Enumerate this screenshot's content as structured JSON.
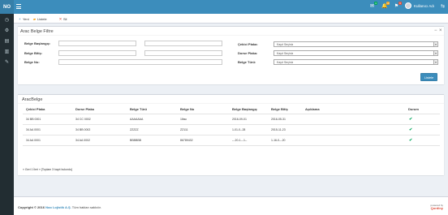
{
  "header": {
    "brand": "NO",
    "user_name": "Kullanıcı Adı",
    "notifications": [
      {
        "icon": "envelope-icon",
        "count": "4",
        "color": "#00a65a"
      },
      {
        "icon": "bell-icon",
        "count": "10",
        "color": "#f39c12"
      },
      {
        "icon": "flag-icon",
        "count": "9",
        "color": "#dd4b39"
      }
    ]
  },
  "sidebar": {
    "icons": [
      "dashboard-icon",
      "settings-icon",
      "chart-icon",
      "file-icon",
      "edit-icon"
    ]
  },
  "toolbar": {
    "new_label": "Yeni",
    "list_label": "Listele",
    "delete_label": "Sil"
  },
  "filter": {
    "title": "Arac Belge Filtre",
    "collapse": "−",
    "close": "×",
    "labels": {
      "start": "Belge Başlangıç:",
      "end": "Belge Bitiş:",
      "no": "Belge No:",
      "tractor_plate": "Çekici Plaka:",
      "trailer_plate": "Dorse Plaka:",
      "doc_type": "Belge Türü:"
    },
    "selects": {
      "tractor_plate": "Kayıt Seçiniz",
      "trailer_plate": "Kayıt Seçiniz",
      "doc_type": "Kayıt Seçiniz"
    },
    "list_button": "Listele"
  },
  "table": {
    "title": "AracBelge",
    "columns": [
      "Çekici Plaka",
      "Dorse Plaka",
      "Belge Türü",
      "Belge No",
      "Belge Başlangıç",
      "Belge Bitiş",
      "Açıklama",
      "Durum"
    ],
    "rows": [
      [
        "34 BB 0001",
        "34 CC 0002",
        "AAAAAAA",
        "1lbsc",
        "2016-09-01",
        "2016-05-31",
        "",
        "check"
      ],
      [
        "34 AA 0001",
        "34 BB 0002",
        "ZZZZZ",
        "ZZ111",
        "1-01-0--28",
        "2015-11-23",
        "",
        "check"
      ],
      [
        "34 AA 0001",
        "34 AA 0002",
        "BBBBBB",
        "86789432",
        "---20-1---1--",
        "1-16-0---20",
        "",
        "check"
      ]
    ],
    "pagination": "« Geri 1 İleri » [Toplam 3 kayıt bulundu]"
  },
  "footer": {
    "copyright_prefix": "Copyright © 2016",
    "company": "Noo Lojistik A.Ş.",
    "rights": "Tüm hakları saklıdır.",
    "powered_by": "powered by",
    "vendor": "Qordiny"
  },
  "colors": {
    "header": "#3c8dbc",
    "sidebar": "#222d32",
    "accent": "#3c8dbc",
    "success": "#00a65a"
  }
}
